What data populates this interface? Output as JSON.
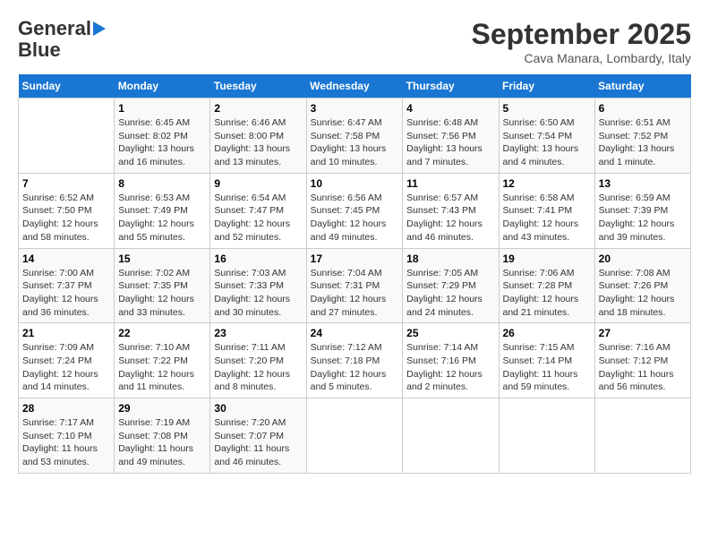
{
  "logo": {
    "line1": "General",
    "line2": "Blue"
  },
  "title": "September 2025",
  "subtitle": "Cava Manara, Lombardy, Italy",
  "days_of_week": [
    "Sunday",
    "Monday",
    "Tuesday",
    "Wednesday",
    "Thursday",
    "Friday",
    "Saturday"
  ],
  "weeks": [
    [
      {
        "day": "",
        "info": ""
      },
      {
        "day": "1",
        "info": "Sunrise: 6:45 AM\nSunset: 8:02 PM\nDaylight: 13 hours\nand 16 minutes."
      },
      {
        "day": "2",
        "info": "Sunrise: 6:46 AM\nSunset: 8:00 PM\nDaylight: 13 hours\nand 13 minutes."
      },
      {
        "day": "3",
        "info": "Sunrise: 6:47 AM\nSunset: 7:58 PM\nDaylight: 13 hours\nand 10 minutes."
      },
      {
        "day": "4",
        "info": "Sunrise: 6:48 AM\nSunset: 7:56 PM\nDaylight: 13 hours\nand 7 minutes."
      },
      {
        "day": "5",
        "info": "Sunrise: 6:50 AM\nSunset: 7:54 PM\nDaylight: 13 hours\nand 4 minutes."
      },
      {
        "day": "6",
        "info": "Sunrise: 6:51 AM\nSunset: 7:52 PM\nDaylight: 13 hours\nand 1 minute."
      }
    ],
    [
      {
        "day": "7",
        "info": "Sunrise: 6:52 AM\nSunset: 7:50 PM\nDaylight: 12 hours\nand 58 minutes."
      },
      {
        "day": "8",
        "info": "Sunrise: 6:53 AM\nSunset: 7:49 PM\nDaylight: 12 hours\nand 55 minutes."
      },
      {
        "day": "9",
        "info": "Sunrise: 6:54 AM\nSunset: 7:47 PM\nDaylight: 12 hours\nand 52 minutes."
      },
      {
        "day": "10",
        "info": "Sunrise: 6:56 AM\nSunset: 7:45 PM\nDaylight: 12 hours\nand 49 minutes."
      },
      {
        "day": "11",
        "info": "Sunrise: 6:57 AM\nSunset: 7:43 PM\nDaylight: 12 hours\nand 46 minutes."
      },
      {
        "day": "12",
        "info": "Sunrise: 6:58 AM\nSunset: 7:41 PM\nDaylight: 12 hours\nand 43 minutes."
      },
      {
        "day": "13",
        "info": "Sunrise: 6:59 AM\nSunset: 7:39 PM\nDaylight: 12 hours\nand 39 minutes."
      }
    ],
    [
      {
        "day": "14",
        "info": "Sunrise: 7:00 AM\nSunset: 7:37 PM\nDaylight: 12 hours\nand 36 minutes."
      },
      {
        "day": "15",
        "info": "Sunrise: 7:02 AM\nSunset: 7:35 PM\nDaylight: 12 hours\nand 33 minutes."
      },
      {
        "day": "16",
        "info": "Sunrise: 7:03 AM\nSunset: 7:33 PM\nDaylight: 12 hours\nand 30 minutes."
      },
      {
        "day": "17",
        "info": "Sunrise: 7:04 AM\nSunset: 7:31 PM\nDaylight: 12 hours\nand 27 minutes."
      },
      {
        "day": "18",
        "info": "Sunrise: 7:05 AM\nSunset: 7:29 PM\nDaylight: 12 hours\nand 24 minutes."
      },
      {
        "day": "19",
        "info": "Sunrise: 7:06 AM\nSunset: 7:28 PM\nDaylight: 12 hours\nand 21 minutes."
      },
      {
        "day": "20",
        "info": "Sunrise: 7:08 AM\nSunset: 7:26 PM\nDaylight: 12 hours\nand 18 minutes."
      }
    ],
    [
      {
        "day": "21",
        "info": "Sunrise: 7:09 AM\nSunset: 7:24 PM\nDaylight: 12 hours\nand 14 minutes."
      },
      {
        "day": "22",
        "info": "Sunrise: 7:10 AM\nSunset: 7:22 PM\nDaylight: 12 hours\nand 11 minutes."
      },
      {
        "day": "23",
        "info": "Sunrise: 7:11 AM\nSunset: 7:20 PM\nDaylight: 12 hours\nand 8 minutes."
      },
      {
        "day": "24",
        "info": "Sunrise: 7:12 AM\nSunset: 7:18 PM\nDaylight: 12 hours\nand 5 minutes."
      },
      {
        "day": "25",
        "info": "Sunrise: 7:14 AM\nSunset: 7:16 PM\nDaylight: 12 hours\nand 2 minutes."
      },
      {
        "day": "26",
        "info": "Sunrise: 7:15 AM\nSunset: 7:14 PM\nDaylight: 11 hours\nand 59 minutes."
      },
      {
        "day": "27",
        "info": "Sunrise: 7:16 AM\nSunset: 7:12 PM\nDaylight: 11 hours\nand 56 minutes."
      }
    ],
    [
      {
        "day": "28",
        "info": "Sunrise: 7:17 AM\nSunset: 7:10 PM\nDaylight: 11 hours\nand 53 minutes."
      },
      {
        "day": "29",
        "info": "Sunrise: 7:19 AM\nSunset: 7:08 PM\nDaylight: 11 hours\nand 49 minutes."
      },
      {
        "day": "30",
        "info": "Sunrise: 7:20 AM\nSunset: 7:07 PM\nDaylight: 11 hours\nand 46 minutes."
      },
      {
        "day": "",
        "info": ""
      },
      {
        "day": "",
        "info": ""
      },
      {
        "day": "",
        "info": ""
      },
      {
        "day": "",
        "info": ""
      }
    ]
  ]
}
